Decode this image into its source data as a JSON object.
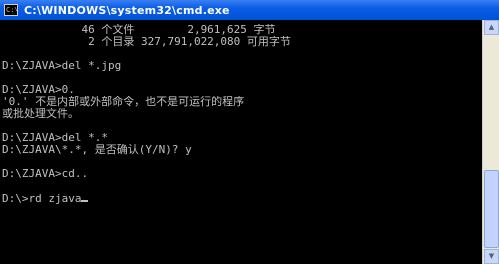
{
  "window": {
    "title": "C:\\WINDOWS\\system32\\cmd.exe",
    "icon": "cmd-icon",
    "icon_text": "C:\\"
  },
  "console": {
    "lines": [
      "            46 个文件        2,961,625 字节",
      "             2 个目录 327,791,022,080 可用字节",
      "",
      "D:\\ZJAVA>del *.jpg",
      "",
      "D:\\ZJAVA>0.",
      "'0.' 不是内部或外部命令，也不是可运行的程序",
      "或批处理文件。",
      "",
      "D:\\ZJAVA>del *.*",
      "D:\\ZJAVA\\*.*, 是否确认(Y/N)? y",
      "",
      "D:\\ZJAVA>cd..",
      "",
      "D:\\>rd zjava"
    ]
  },
  "colors": {
    "titlebar": "#0a5ee6",
    "console_bg": "#000000",
    "console_text": "#c0c0c0"
  }
}
